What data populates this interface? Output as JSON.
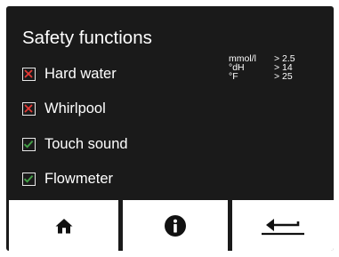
{
  "screen": {
    "title": "Safety functions"
  },
  "items": [
    {
      "label": "Hard water",
      "checked": false,
      "icon": "x-mark-icon",
      "color": "#e53935"
    },
    {
      "label": "Whirlpool",
      "checked": false,
      "icon": "x-mark-icon",
      "color": "#e53935"
    },
    {
      "label": "Touch sound",
      "checked": true,
      "icon": "check-mark-icon",
      "color": "#43a047"
    },
    {
      "label": "Flowmeter",
      "checked": true,
      "icon": "check-mark-icon",
      "color": "#43a047"
    }
  ],
  "hardness_info": [
    {
      "unit": "mmol/l",
      "value": "> 2.5"
    },
    {
      "unit": "°dH",
      "value": "> 14"
    },
    {
      "unit": "°F",
      "value": "> 25"
    }
  ],
  "buttons": {
    "home_icon": "home-icon",
    "info_icon": "info-icon",
    "back_icon": "return-arrow-icon"
  }
}
